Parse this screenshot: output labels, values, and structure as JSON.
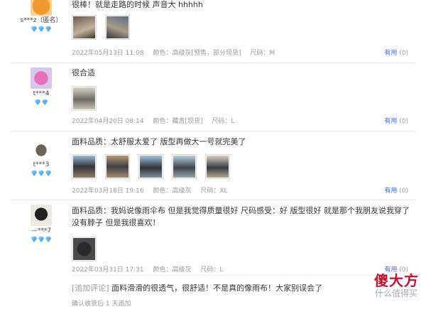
{
  "reviews": [
    {
      "user": "s***z（匿名）",
      "text": "很棒！就是走路的时候 声音大 hhhhh",
      "date": "2022年05月13日 11:08",
      "color": "颜色：高级灰[预售，部分现货]",
      "size": "尺码：M",
      "useful_label": "有用",
      "useful_count": "(0)"
    },
    {
      "user": "t***4",
      "text": "很合适",
      "date": "2022年04月20日 08:14",
      "color": "颜色：藏青[现货]",
      "size": "尺码：L",
      "useful_label": "有用",
      "useful_count": "(0)"
    },
    {
      "user": "t***3",
      "text": "面料品质：太舒服太爱了 版型再做大一号就完美了",
      "date": "2022年03月18日 19:16",
      "color": "颜色：高级灰",
      "size": "尺码：XL",
      "useful_label": "有用",
      "useful_count": "(0)"
    },
    {
      "user": "—***7",
      "text": "面料品质：我妈说像雨伞布 但是我觉得质量很好 尺码感受：好 版型很好 就是那个我朋友说我穿了没有脖子 但是我很喜欢！",
      "date": "2022年03月31日 17:31",
      "color": "颜色：高级灰",
      "size": "尺码：L",
      "useful_label": "有用",
      "useful_count": "(0)",
      "append_tag": "[追加评论]",
      "append_text": "面料滑滑的很透气，很舒适！不是真的像雨布！大家别误会了",
      "append_sub": "确认收货后 1 天追加"
    }
  ],
  "watermark": {
    "main": "傻大方",
    "sub": "什么值得买"
  },
  "colors": {
    "link": "#3b6fc9",
    "meta": "#999999",
    "divider": "#e5e5e5"
  }
}
